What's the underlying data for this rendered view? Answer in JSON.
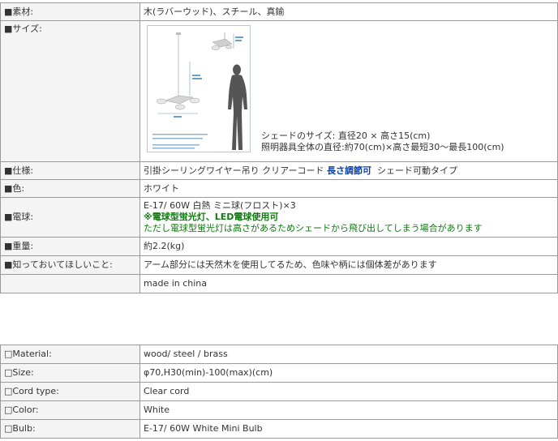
{
  "jp": {
    "material_label": "■素材:",
    "material_value": "木(ラバーウッド)、スチール、真鍮",
    "size_label": "■サイズ:",
    "size_line1": "シェードのサイズ: 直径20 × 高さ15(cm)",
    "size_line2": "照明器具全体の直径:約70(cm)×高さ最短30～最長100(cm)",
    "spec_label": "■仕様:",
    "spec_value_a": "引掛シーリングワイヤー吊り クリアーコード",
    "spec_value_highlight": "長さ調節可",
    "spec_value_b": "シェード可動タイプ",
    "color_label": "■色:",
    "color_value": "ホワイト",
    "bulb_label": "■電球:",
    "bulb_line1": "E-17/ 60W 白熱  ミニ球(フロスト)×3",
    "bulb_line2": "※電球型蛍光灯、LED電球使用可",
    "bulb_line3": "ただし電球型蛍光灯は高さがあるためシェードから飛び出してしまう場合があります",
    "weight_label": "■重量:",
    "weight_value": "約2.2(kg)",
    "notice_label": "■知っておいてほしいこと:",
    "notice_value": "アーム部分には天然木を使用してるため、色味や柄には個体差があります",
    "origin_label": "",
    "origin_value": "made in china"
  },
  "en": {
    "material_label": "□Material:",
    "material_value": "wood/ steel / brass",
    "size_label": "□Size:",
    "size_value": "φ70,H30(min)-100(max)(cm)",
    "cord_label": "□Cord type:",
    "cord_value": "Clear cord",
    "color_label": "□Color:",
    "color_value": "White",
    "bulb_label": "□Bulb:",
    "bulb_value": "E-17/ 60W White Mini Bulb"
  },
  "colors": {
    "highlight_blue": "#0b3fa8",
    "note_green": "#0f7a0f",
    "label_bg": "#f4f4f4",
    "border": "#9a9a9a"
  }
}
